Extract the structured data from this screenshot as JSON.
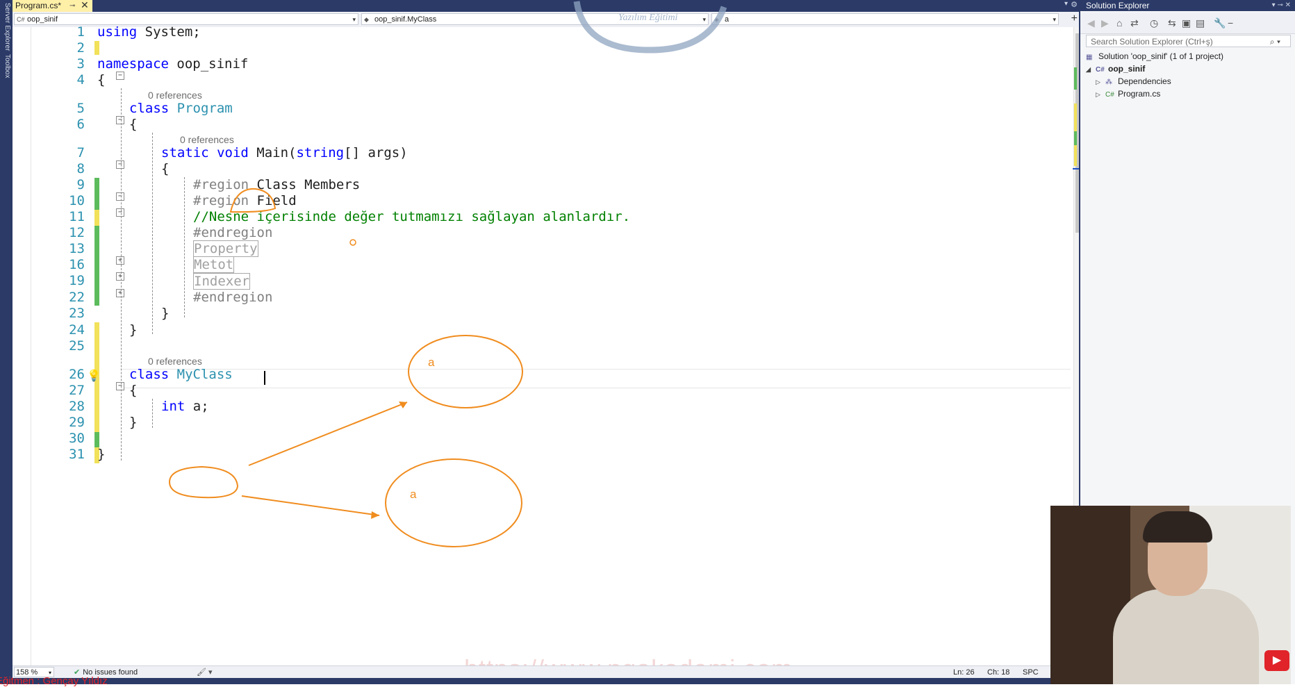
{
  "window": {
    "tab_title": "Program.cs*",
    "left_strip_tabs": [
      "Server Explorer",
      "Toolbox"
    ]
  },
  "navbar": {
    "project": "oop_sinif",
    "type": "oop_sinif.MyClass",
    "member": "a"
  },
  "editor": {
    "line_numbers": [
      "1",
      "2",
      "3",
      "4",
      "5",
      "6",
      "7",
      "8",
      "9",
      "10",
      "11",
      "12",
      "13",
      "16",
      "19",
      "22",
      "23",
      "24",
      "25",
      "26",
      "27",
      "28",
      "29",
      "30",
      "31"
    ],
    "codelens": {
      "program": "0 references",
      "main": "0 references",
      "myclass": "0 references"
    },
    "lines": {
      "l1_kw": "using",
      "l1_rest": " System;",
      "l3_kw": "namespace",
      "l3_rest": " oop_sinif",
      "l4": "{",
      "l5_kw": "class",
      "l5_type": " Program",
      "l6": "{",
      "l7_kw": "static void",
      "l7_name": " Main(",
      "l7_kw2": "string",
      "l7_rest": "[] args)",
      "l8": "{",
      "l9_pre": "#region",
      "l9_rest": " Class Members",
      "l10_pre": "#region",
      "l10_rest": " Field",
      "l11": "//Nesne içerisinde değer tutmamızı sağlayan alanlardır.",
      "l12": "#endregion",
      "l13": "Property",
      "l16": "Metot",
      "l19": "Indexer",
      "l22": "#endregion",
      "l23": "}",
      "l24": "}",
      "l26_kw": "class",
      "l26_type": " MyClass",
      "l27": "{",
      "l28_kw": "int",
      "l28_rest": " a;",
      "l29": "}",
      "l31": "}"
    }
  },
  "annotations": {
    "ellipse_top_label": "a",
    "ellipse_bottom_label": "a",
    "accent_color": "#f08c1e"
  },
  "watermark": {
    "logo_text": "Yazılım Eğitimi",
    "url": "https://www.ngakademi.com"
  },
  "statusbar": {
    "zoom": "158 %",
    "issues": "No issues found",
    "line": "Ln: 26",
    "char": "Ch: 18",
    "indent": "SPC"
  },
  "instructor": "Eğitmen : Gençay Yıldız",
  "solution_explorer": {
    "title": "Solution Explorer",
    "search_placeholder": "Search Solution Explorer (Ctrl+ş)",
    "tree": {
      "solution": "Solution 'oop_sinif' (1 of 1 project)",
      "project": "oop_sinif",
      "dependencies": "Dependencies",
      "program_file": "Program.cs"
    }
  },
  "colors": {
    "chrome_dark": "#2b3a67",
    "tab_active": "#fff0a8",
    "keyword": "#0000ff",
    "type": "#2b91af",
    "comment": "#008000",
    "line_number": "#2b91af",
    "change_saved": "#5cbb5c",
    "change_unsaved": "#f2e15a"
  }
}
